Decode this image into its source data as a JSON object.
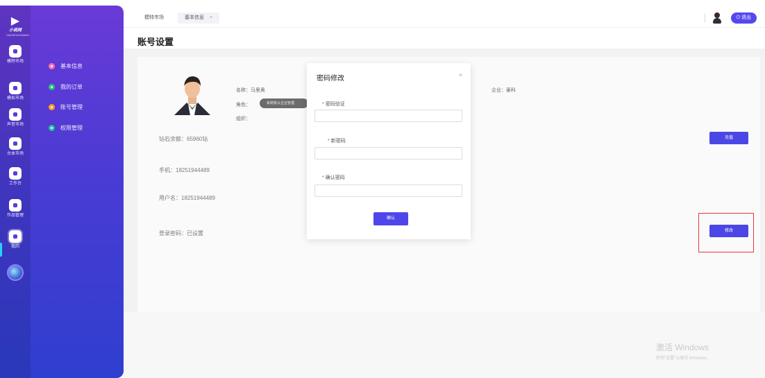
{
  "app": {
    "logo_text": "小说网",
    "logo_sub": "XIAOSHUOWANG"
  },
  "rail": {
    "items": [
      {
        "label": "模特市场",
        "icon": "market-icon"
      },
      {
        "label": "模拟市场",
        "icon": "simulate-icon"
      },
      {
        "label": "声音市场",
        "icon": "sound-icon"
      },
      {
        "label": "台本市场",
        "icon": "script-icon"
      },
      {
        "label": "工作台",
        "icon": "workbench-icon"
      },
      {
        "label": "作品管理",
        "icon": "works-icon"
      },
      {
        "label": "我的",
        "icon": "user-icon"
      }
    ]
  },
  "submenu": {
    "items": [
      {
        "label": "基本信息",
        "color": "#ff6ea8"
      },
      {
        "label": "我的订单",
        "color": "#27c27a"
      },
      {
        "label": "账号管理",
        "color": "#ff9a2e"
      },
      {
        "label": "权限管理",
        "color": "#26c0a3"
      }
    ]
  },
  "tabs": [
    {
      "label": "模特市场"
    },
    {
      "label": "基本信息",
      "close": "×"
    }
  ],
  "header": {
    "logout_label": "⏻ 退出"
  },
  "page": {
    "title": "账号设置",
    "name_label": "名称：马里奥",
    "role_label": "角色：",
    "role_value": "系统默认企业管理",
    "org_label": "组织：",
    "company_label": "企业：豪科",
    "balance_label": "钻石余额：65960钻",
    "phone_label": "手机：18251944489",
    "username_label": "用户名：18251944489",
    "password_label": "登录密码：已设置",
    "dot": "·",
    "recharge_label": "充值",
    "modify_label": "修改"
  },
  "modal": {
    "title": "密码修改",
    "close": "×",
    "fields": [
      {
        "label": "密码验证",
        "value": ""
      },
      {
        "label": "新密码",
        "value": ""
      },
      {
        "label": "确认密码",
        "value": ""
      }
    ],
    "required_mark": "*",
    "confirm_label": "确认"
  },
  "watermark": {
    "line1": "激活 Windows",
    "line2": "转到\"设置\"以激活 Windows。"
  },
  "colors": {
    "accent": "#4a47e6",
    "highlight": "#e53935",
    "rail_top": "#6a3ad6",
    "rail_bottom": "#2f3fcf"
  }
}
